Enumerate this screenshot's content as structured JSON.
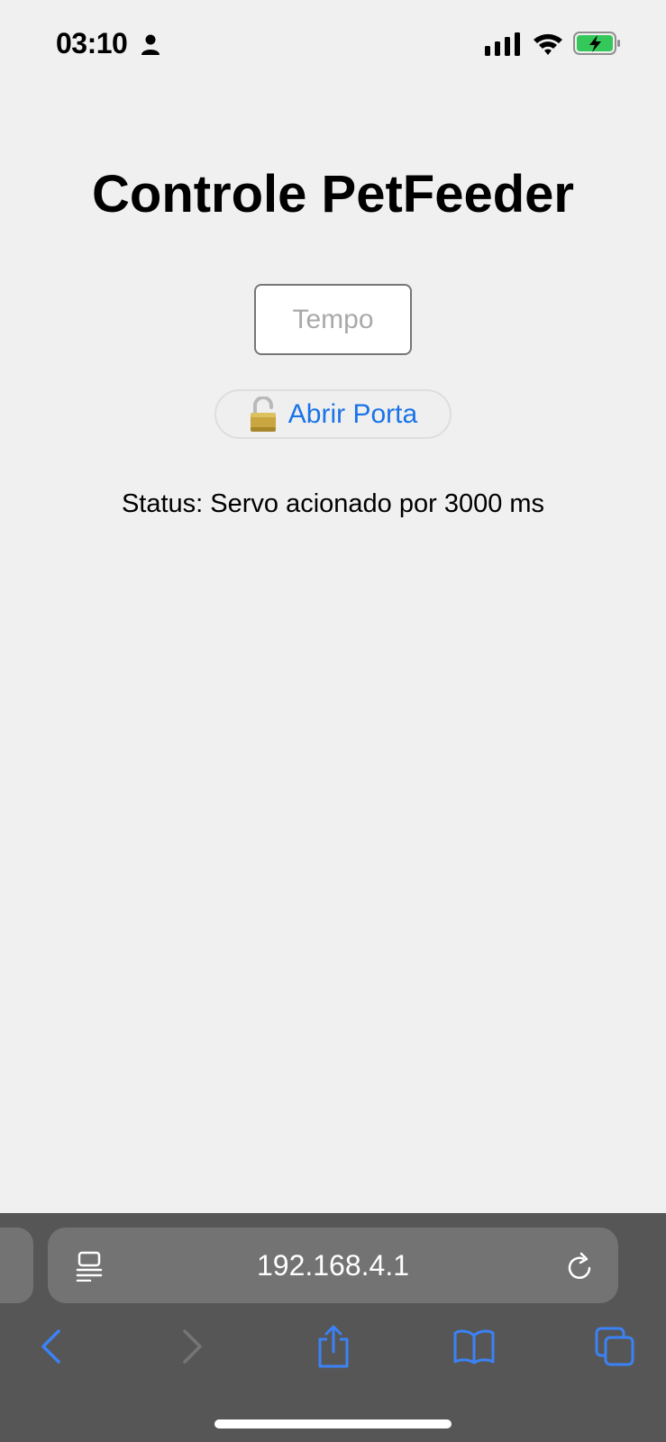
{
  "status_bar": {
    "time": "03:10",
    "icons": [
      "person-icon",
      "cellular-signal-icon",
      "wifi-icon",
      "battery-charging-icon"
    ],
    "battery_color": "#34c759"
  },
  "page": {
    "title": "Controle PetFeeder",
    "tempo_input": {
      "placeholder": "Tempo",
      "value": ""
    },
    "open_button": {
      "icon": "unlocked-padlock-icon",
      "label": "Abrir Porta"
    },
    "status": "Status: Servo acionado por 3000 ms"
  },
  "browser": {
    "url": "192.168.4.1",
    "toolbar": [
      "back-icon",
      "forward-icon",
      "share-icon",
      "bookmarks-icon",
      "tabs-icon"
    ],
    "accent_color": "#3b82f6"
  }
}
